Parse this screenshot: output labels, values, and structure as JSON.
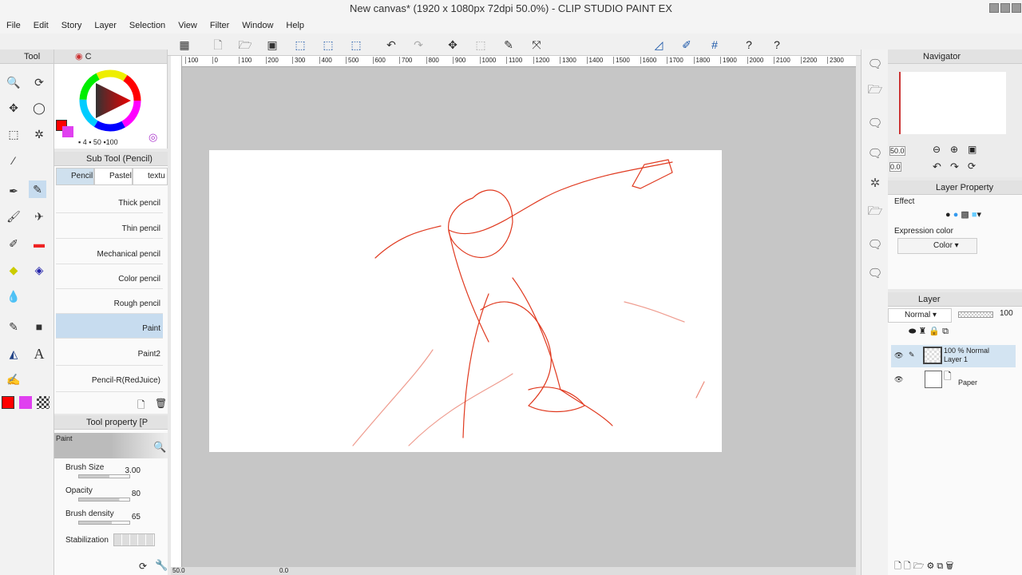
{
  "window": {
    "title": "New canvas* (1920 x 1080px 72dpi 50.0%) - CLIP STUDIO PAINT EX"
  },
  "menu": [
    "File",
    "Edit",
    "Story",
    "Layer",
    "Selection",
    "View",
    "Filter",
    "Window",
    "Help"
  ],
  "tool_panel": {
    "tab": "Tool",
    "tools": [
      "zoom-icon",
      "rotate-icon",
      "move-icon",
      "lasso-icon",
      "selection-icon",
      "magic-wand-icon",
      "eyedropper-icon",
      "pen-icon",
      "pencil-icon",
      "brush-icon",
      "airbrush-icon",
      "decoration-icon",
      "eraser-icon",
      "fill-icon",
      "blend-icon",
      "gradient-icon",
      "figure-icon",
      "text-icon",
      "balloon-icon",
      "correct-line-icon"
    ]
  },
  "color_panel": {
    "tab": "C",
    "main_color": "#ff0000",
    "sub_color": "#e040f0",
    "values": [
      "4",
      "50",
      "100"
    ]
  },
  "sub_tool": {
    "title": "Sub Tool (Pencil)",
    "tabs": [
      "Pencil",
      "Pastel",
      "textu"
    ],
    "brushes": [
      "Thick pencil",
      "Thin pencil",
      "Mechanical pencil",
      "Color pencil",
      "Rough pencil",
      "Paint",
      "Paint2",
      "Pencil-R(RedJuice)"
    ],
    "selected": "Paint"
  },
  "tool_property": {
    "title": "Tool property [P",
    "preset": "Paint",
    "props": [
      {
        "label": "Brush Size",
        "value": "3.00",
        "fill": 0.6
      },
      {
        "label": "Opacity",
        "value": "80",
        "fill": 0.8
      },
      {
        "label": "Brush density",
        "value": "65",
        "fill": 0.65
      },
      {
        "label": "Stabilization",
        "value": ""
      }
    ]
  },
  "ruler": {
    "labels": [
      "100",
      "0",
      "100",
      "200",
      "300",
      "400",
      "500",
      "600",
      "700",
      "800",
      "900",
      "1000",
      "1100",
      "1200",
      "1300",
      "1400",
      "1500",
      "1600",
      "1700",
      "1800",
      "1900",
      "2000",
      "2100",
      "2200",
      "2300"
    ]
  },
  "navigator": {
    "title": "Navigator",
    "zoom": "50.0",
    "rotate": "0.0"
  },
  "layer_property": {
    "title": "Layer Property",
    "effect_label": "Effect",
    "expression_label": "Expression color",
    "expression_value": "Color"
  },
  "layer_panel": {
    "title": "Layer",
    "blend_mode": "Normal",
    "opacity": "100",
    "layers": [
      {
        "info": "100 % Normal",
        "name": "Layer 1"
      },
      {
        "info": "",
        "name": "Paper"
      }
    ]
  },
  "status": {
    "zoom": "50.0",
    "angle": "0.0"
  }
}
